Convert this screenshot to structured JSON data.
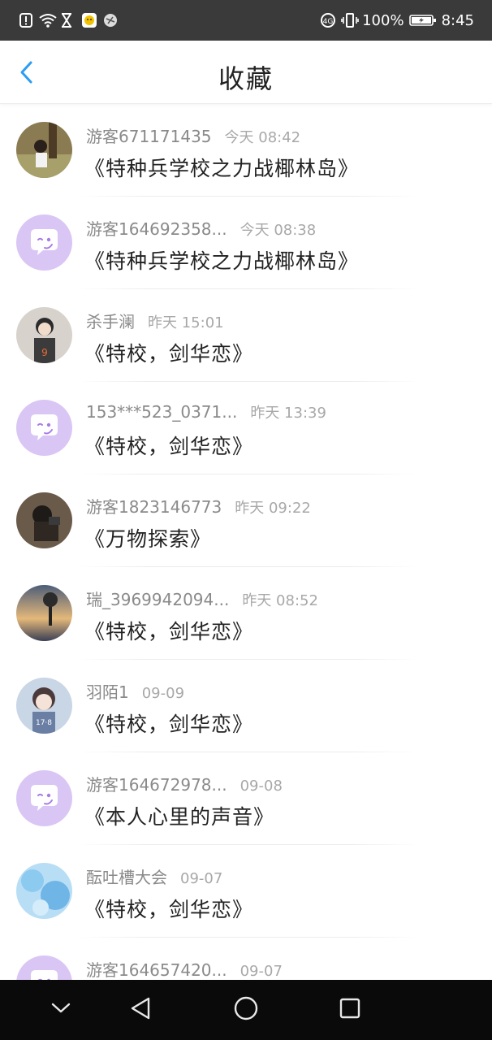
{
  "status_bar": {
    "battery": "100%",
    "time": "8:45",
    "left_icons": [
      "alert-icon",
      "wifi-icon",
      "hourglass-icon",
      "app-notification-icon",
      "app-notification-icon-2"
    ],
    "right_icons": [
      "data-saver-icon",
      "vibrate-icon",
      "battery-icon"
    ]
  },
  "header": {
    "title": "收藏",
    "back_icon": "chevron-left-icon",
    "accent": "#2a9df4"
  },
  "items": [
    {
      "username": "游客671171435",
      "time": "今天 08:42",
      "title": "《特种兵学校之力战椰林岛》",
      "avatar": "photo-girl-park"
    },
    {
      "username": "游客164692358...",
      "time": "今天 08:38",
      "title": "《特种兵学校之力战椰林岛》",
      "avatar": "default-chat"
    },
    {
      "username": "杀手澜",
      "time": "昨天 15:01",
      "title": "《特校，剑华恋》",
      "avatar": "anime-boy"
    },
    {
      "username": "153***523_0371...",
      "time": "昨天 13:39",
      "title": "《特校，剑华恋》",
      "avatar": "default-chat"
    },
    {
      "username": "游客1823146773",
      "time": "昨天 09:22",
      "title": "《万物探索》",
      "avatar": "photo-camera-person"
    },
    {
      "username": "瑞_3969942094...",
      "time": "昨天 08:52",
      "title": "《特校，剑华恋》",
      "avatar": "photo-sunset-tree"
    },
    {
      "username": "羽陌1",
      "time": "09-09",
      "title": "《特校，剑华恋》",
      "avatar": "anime-girl"
    },
    {
      "username": "游客164672978...",
      "time": "09-08",
      "title": "《本人心里的声音》",
      "avatar": "default-chat"
    },
    {
      "username": "酝吐槽大会",
      "time": "09-07",
      "title": "《特校，剑华恋》",
      "avatar": "photo-blue-water"
    },
    {
      "username": "游客164657420...",
      "time": "09-07",
      "title": "",
      "avatar": "default-chat"
    }
  ],
  "nav_bar": {
    "buttons": [
      "hide-keyboard-icon",
      "back-triangle-icon",
      "home-circle-icon",
      "recents-square-icon"
    ]
  },
  "colors": {
    "default_avatar_bg": "#d9c6f4",
    "default_avatar_fg": "#a97be6",
    "status_bar_bg": "#3a3a3a",
    "nav_bar_bg": "#0a0a0a"
  }
}
